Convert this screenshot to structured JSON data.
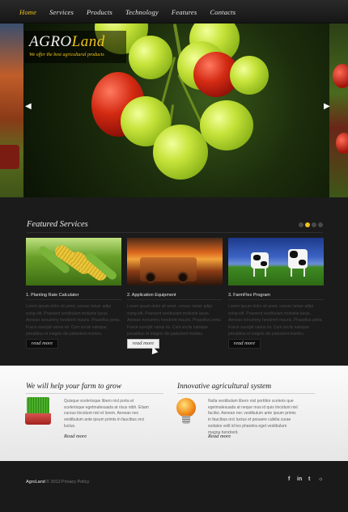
{
  "nav": {
    "items": [
      "Home",
      "Services",
      "Products",
      "Technology",
      "Features",
      "Contacts"
    ],
    "active": "Home",
    "accent_color": "#f0c419"
  },
  "hero": {
    "brand_part1": "AGRO",
    "brand_part2": "Land",
    "tagline": "We offer the best agricultural products",
    "prev_icon": "arrow-left-icon",
    "next_icon": "arrow-right-icon",
    "prev_glyph": "◀",
    "next_glyph": "▶"
  },
  "featured": {
    "title": "Featured Services",
    "slide_count": 4,
    "active_dot": 2,
    "cards": [
      {
        "title": "1. Planting Rate Calculator",
        "text": "Lorem ipsum dolor sit amet, consec tetuer adipi scing elit. Praesent vestibulum molestie lacus. Aenean nonummy hendrerit mauris. Phasellus porta. Fusce suscipit varius mi. Cum sociis natoque penatibus et magnis dis parturient montes.",
        "button": "read more"
      },
      {
        "title": "2. Application Equipment",
        "text": "Lorem ipsum dolor sit amet, consec tetuer adipi scing elit. Praesent vestibulum molestie lacus. Aenean nonummy hendrerit mauris. Phasellus porta. Fusce suscipit varius mi. Cum sociis natoque penatibus et magnis dis parturient montes.",
        "button": "read more"
      },
      {
        "title": "3. FarmFlex Program",
        "text": "Lorem ipsum dolor sit amet, consec tetuer adipi scing elit. Praesent vestibulum molestie lacus. Aenean nonummy hendrerit mauris. Phasellus porta. Fusce suscipit varius mi. Cum sociis natoque penatibus et magnis dis parturient montes.",
        "button": "read more"
      }
    ]
  },
  "info": {
    "left": {
      "title": "We will help your farm to grow",
      "text": "Quisque scelerisque libero nisl porta et scelerisque egetmalesuada at risus nibh. Etiam cursus tincidunt nisl et lorem. Aenean nec vestibulum ante ipsum primis in faucibus orci luctus.",
      "link": "Read more",
      "icon": "plant-pot-icon"
    },
    "right": {
      "title": "Innovative agricultural system",
      "text": "Nulla vestibulum libero nisl porttitor sceleris que egetmalesuada at neque mus id quis tincidunt nisl facilisi. Aenean nec vestibulum ante ipsum primis in faucibus orci luctus et posuere cubilia curae sodales velit id leo pharetra eget vestibulum magna hendrerit.",
      "link": "Read more",
      "icon": "light-bulb-icon"
    }
  },
  "footer": {
    "brand": "AgroLand",
    "copyright": "© 2012",
    "policy": "Privacy Policy",
    "social": [
      {
        "icon": "facebook-icon",
        "glyph": "f"
      },
      {
        "icon": "linkedin-icon",
        "glyph": "in"
      },
      {
        "icon": "twitter-icon",
        "glyph": "t"
      },
      {
        "icon": "rss-icon",
        "glyph": "☼"
      }
    ]
  }
}
